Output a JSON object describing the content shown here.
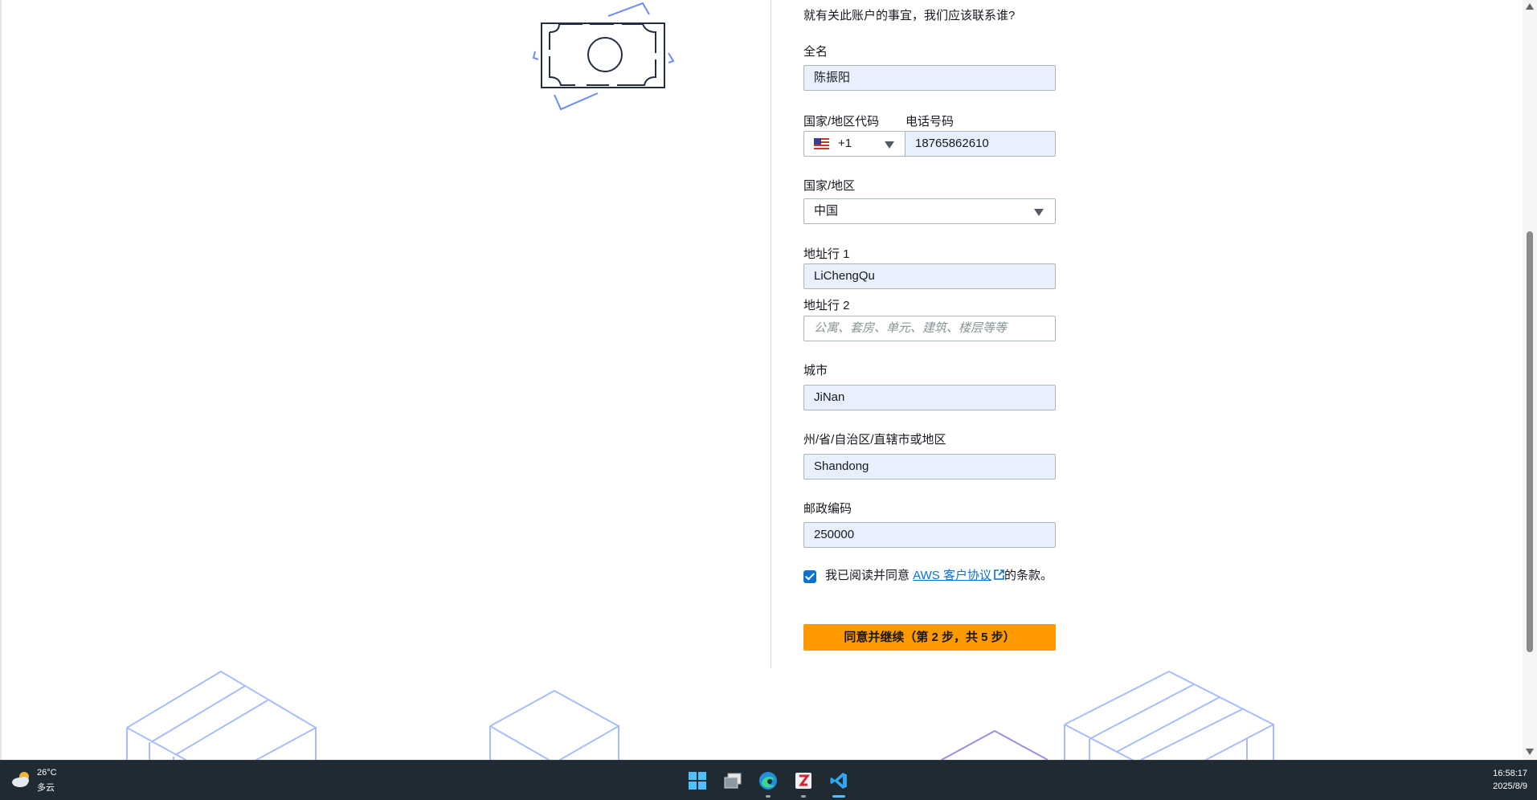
{
  "form": {
    "heading": "就有关此账户的事宜，我们应该联系谁?",
    "full_name": {
      "label": "全名",
      "value": "陈振阳"
    },
    "country_code": {
      "label": "国家/地区代码",
      "value": "+1"
    },
    "phone": {
      "label": "电话号码",
      "value": "18765862610"
    },
    "country": {
      "label": "国家/地区",
      "value": "中国"
    },
    "address1": {
      "label": "地址行 1",
      "value": "LiChengQu"
    },
    "address2": {
      "label": "地址行 2",
      "placeholder": "公寓、套房、单元、建筑、楼层等等"
    },
    "city": {
      "label": "城市",
      "value": "JiNan"
    },
    "state": {
      "label": "州/省/自治区/直辖市或地区",
      "value": "Shandong"
    },
    "postal": {
      "label": "邮政编码",
      "value": "250000"
    },
    "agreement": {
      "checked": true,
      "prefix": "我已阅读并同意 ",
      "link": "AWS 客户协议",
      "suffix": "的条款。"
    },
    "submit_label": "同意并继续（第 2 步，共 5 步）"
  },
  "taskbar": {
    "weather_temp": "26°C",
    "weather_desc": "多云",
    "time": "16:58:17",
    "date": "2025/8/9",
    "apps": [
      "start-icon",
      "task-view-icon",
      "edge-browser-icon",
      "zotero-icon",
      "vscode-icon"
    ]
  },
  "colors": {
    "accent": "#ff9900",
    "link": "#0972d3",
    "autofill_bg": "#e8f0fe",
    "illustration": "#8fa9f5"
  }
}
